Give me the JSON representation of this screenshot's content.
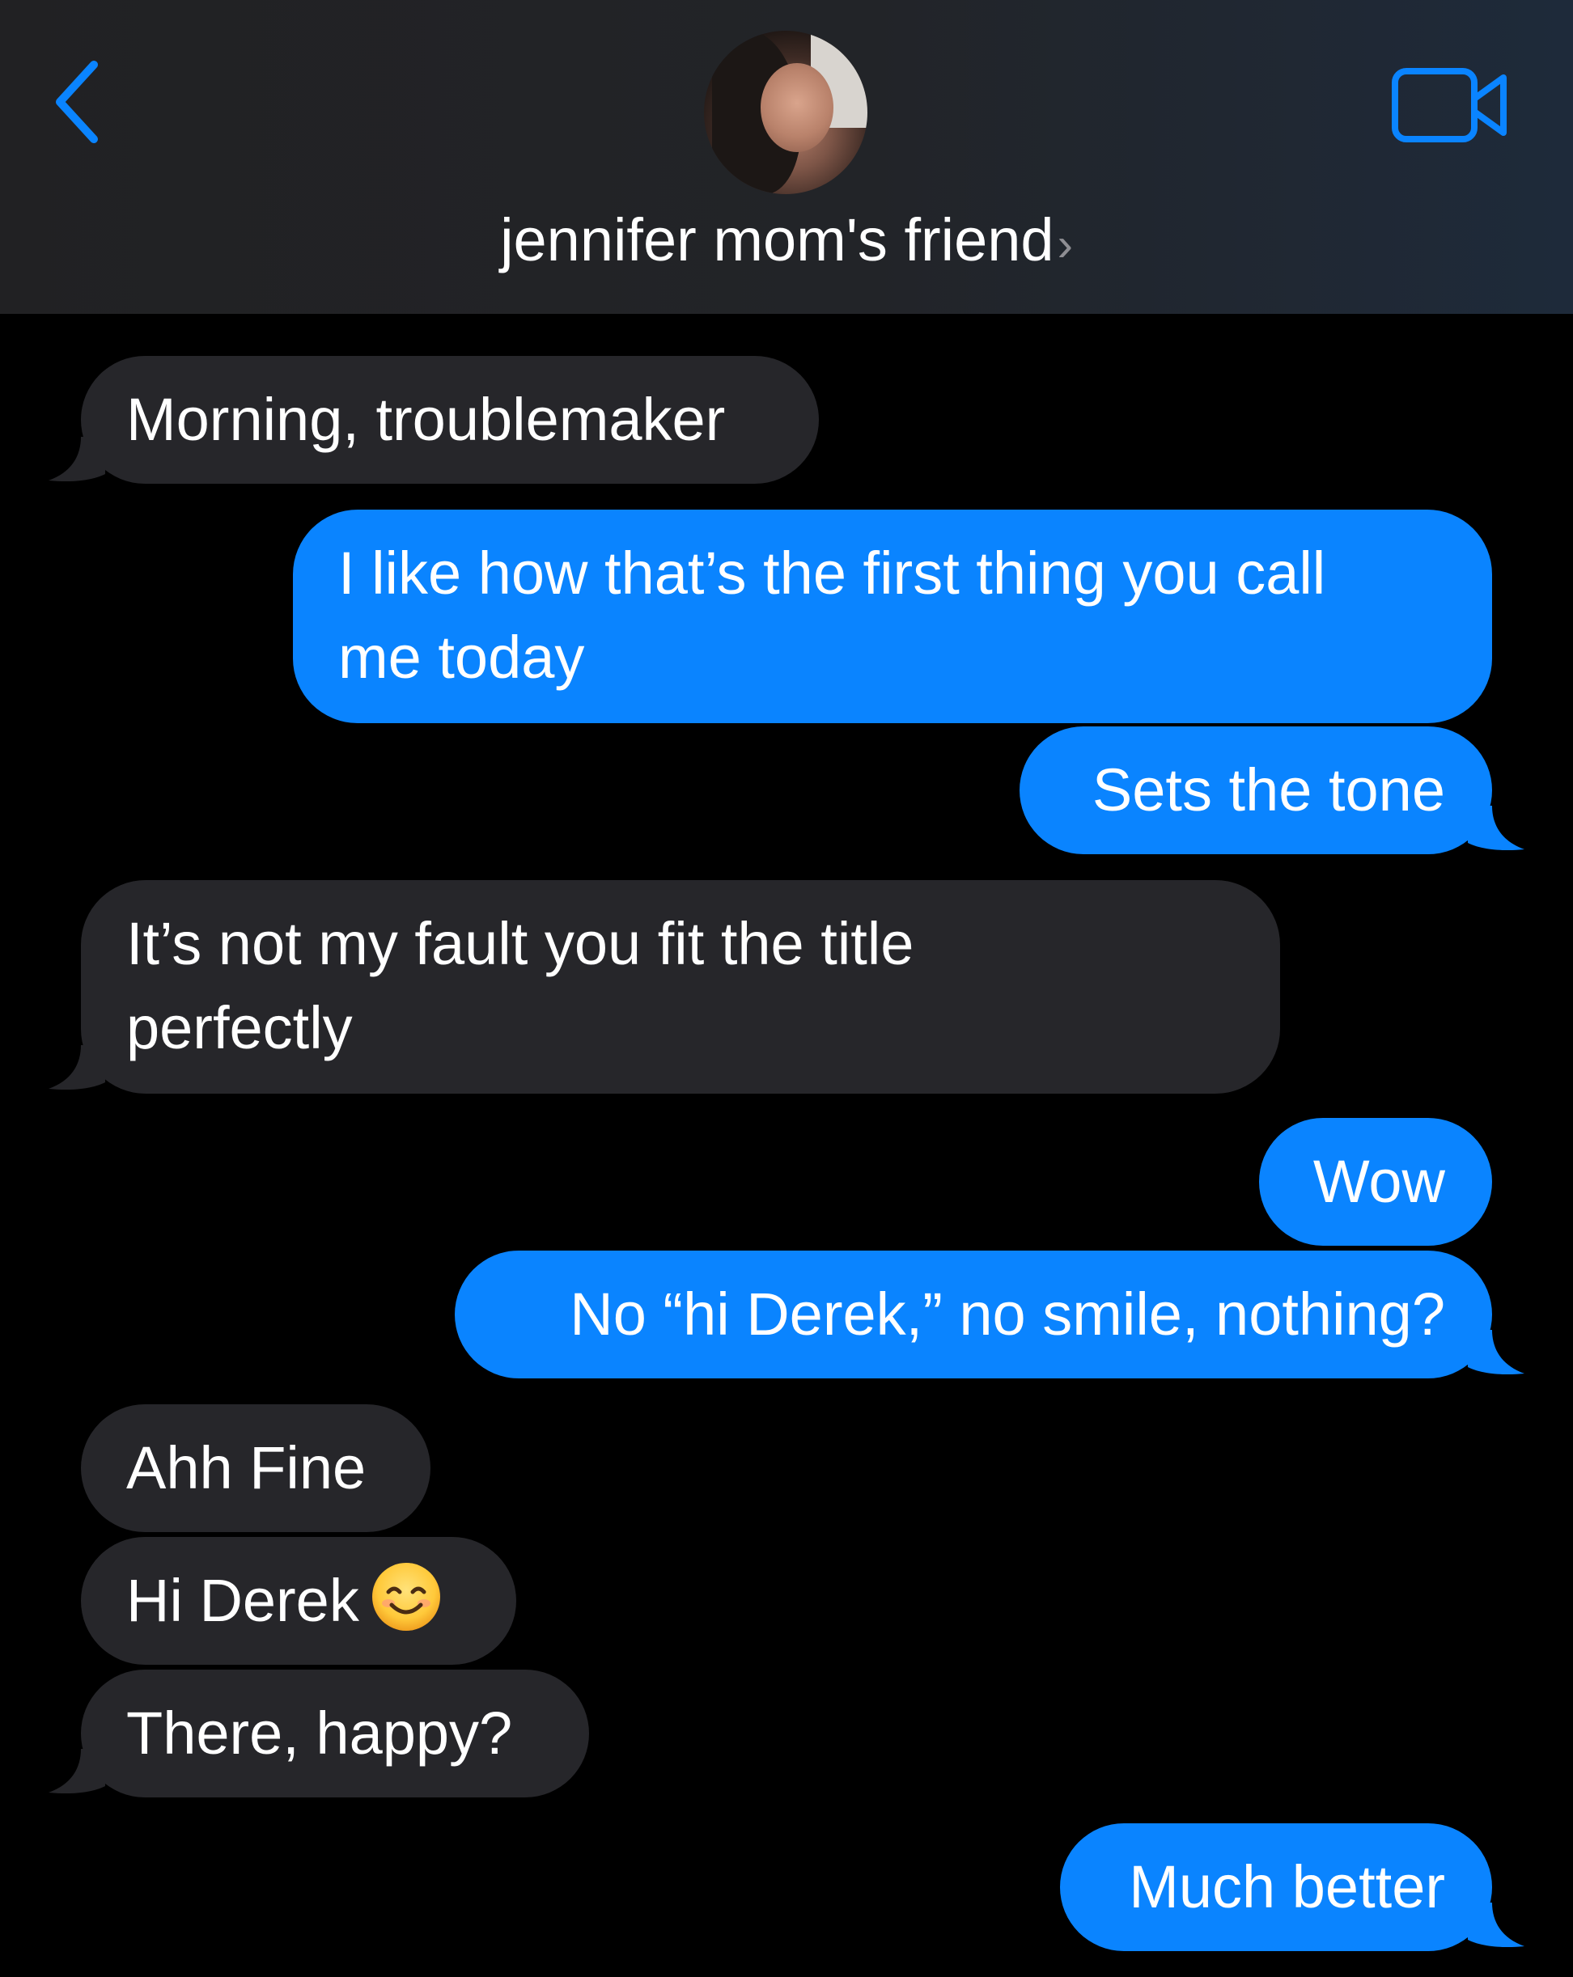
{
  "header": {
    "contact_name": "jennifer mom's friend",
    "chevron": "›",
    "back_icon": "chevron-left-icon",
    "video_icon": "video-camera-icon",
    "accent_color": "#0a84ff"
  },
  "messages": [
    {
      "direction": "incoming",
      "text": "Morning, troublemaker"
    },
    {
      "direction": "outgoing",
      "line1": "I like how that’s the first thing you call",
      "line2": "me today"
    },
    {
      "direction": "outgoing",
      "text": "Sets the tone"
    },
    {
      "direction": "incoming",
      "line1": "It’s not my fault you fit the title",
      "line2": "perfectly"
    },
    {
      "direction": "outgoing",
      "text": "Wow"
    },
    {
      "direction": "outgoing",
      "text": "No “hi Derek,” no smile, nothing?"
    },
    {
      "direction": "incoming",
      "text": "Ahh Fine"
    },
    {
      "direction": "incoming",
      "text": "Hi Derek",
      "emoji": "smiling-face-icon"
    },
    {
      "direction": "incoming",
      "text": "There, happy?"
    },
    {
      "direction": "outgoing",
      "text": "Much better"
    }
  ],
  "colors": {
    "incoming_bubble": "#26262a",
    "outgoing_bubble": "#0a84ff",
    "background": "#000000"
  }
}
